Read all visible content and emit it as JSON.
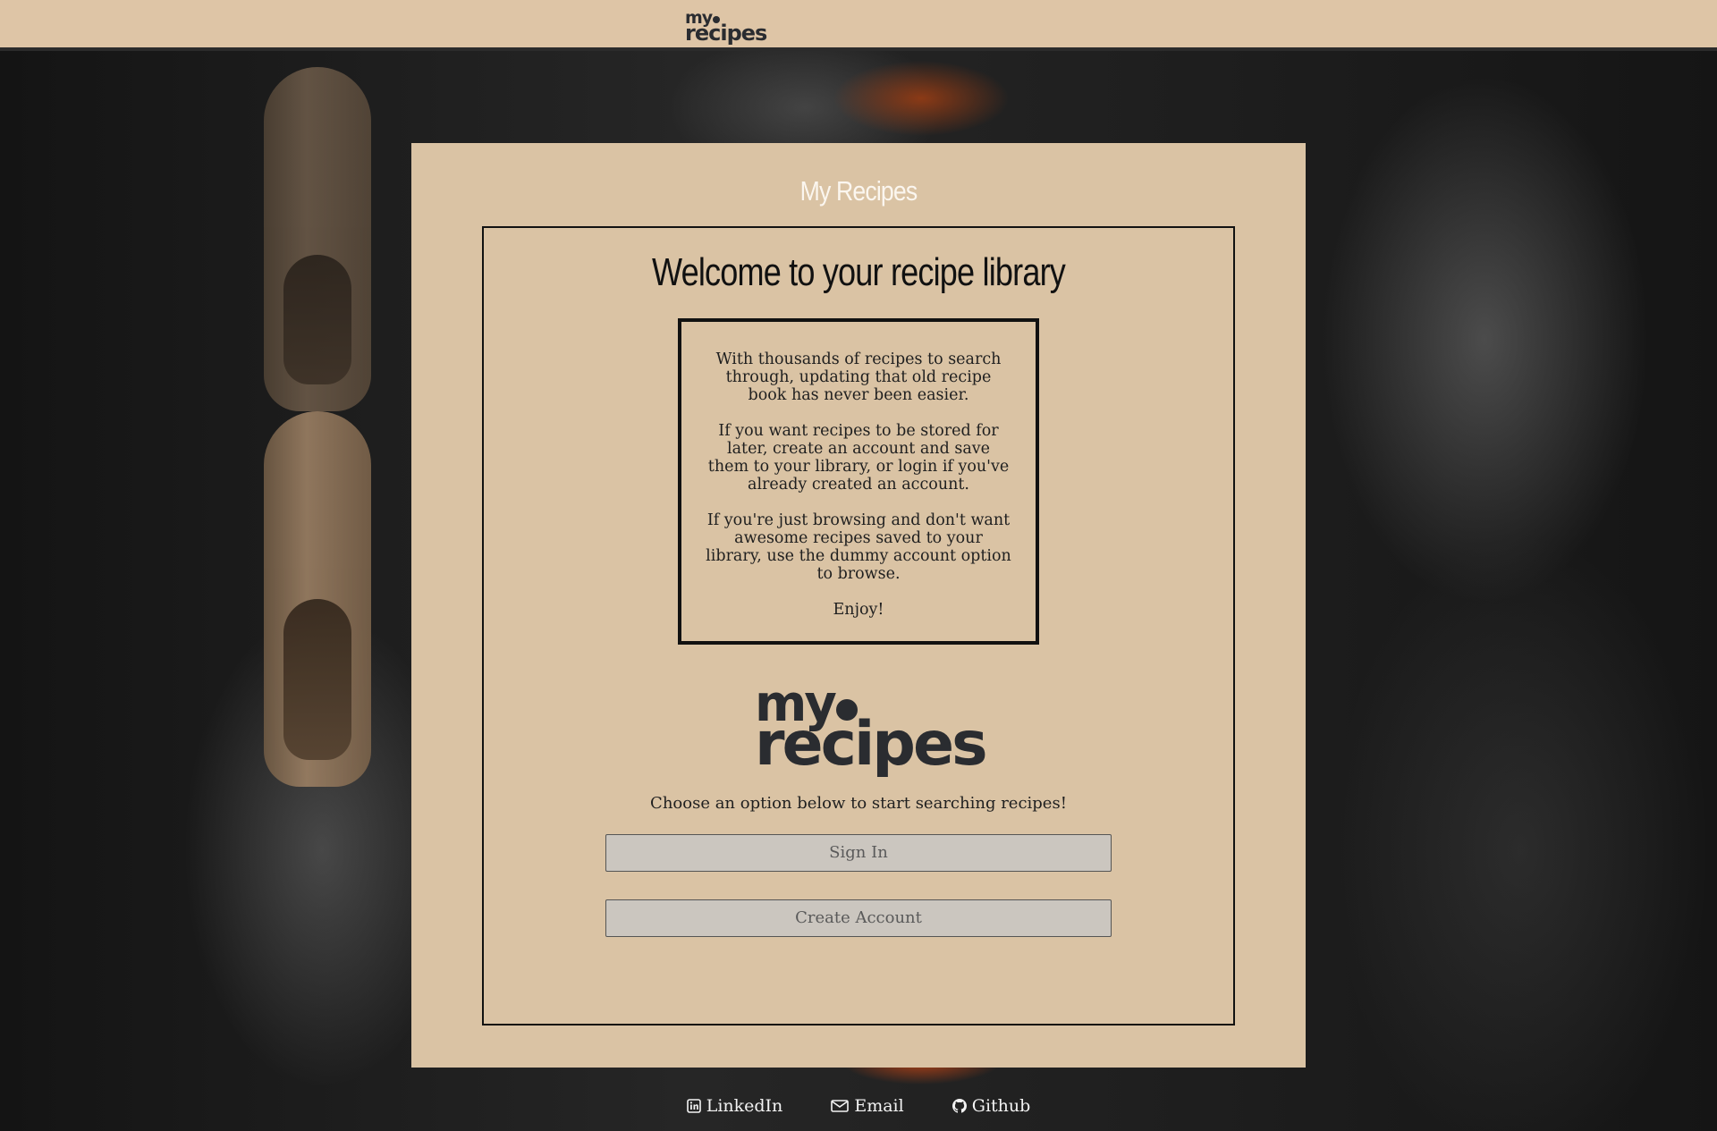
{
  "header": {
    "logo_line1": "my",
    "logo_line2": "recipes"
  },
  "card": {
    "title": "My Recipes",
    "headline": "Welcome to your recipe library",
    "intro": [
      "With thousands of recipes to search through, updating that old recipe book has never been easier.",
      "If you want recipes to be stored for later, create an account and save them to your library, or login if you've already created an account.",
      "If you're just browsing and don't want awesome recipes saved to your library, use the dummy account option to browse.",
      "Enjoy!"
    ],
    "logo_line1": "my",
    "logo_line2": "recipes",
    "choose_text": "Choose an option below to start searching recipes!",
    "signin_label": "Sign In",
    "create_label": "Create Account"
  },
  "footer": {
    "linkedin_label": "LinkedIn",
    "email_label": "Email",
    "github_label": "Github",
    "linkedin_icon": "linkedin-icon",
    "email_icon": "envelope-icon",
    "github_icon": "github-icon"
  },
  "colors": {
    "header_bg": "#dec5a6",
    "card_bg": "#dac3a4",
    "logo": "#2a2c30",
    "button_bg": "#cbc6bf"
  }
}
